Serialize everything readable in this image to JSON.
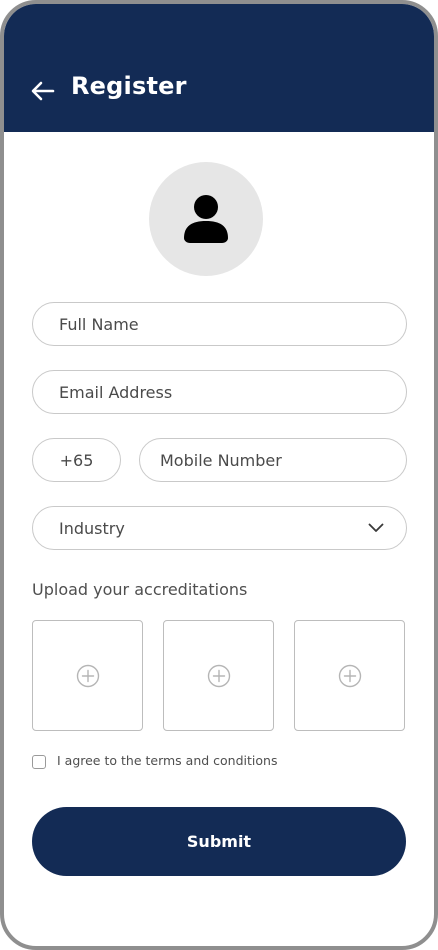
{
  "header": {
    "title": "Register",
    "back_icon": "arrow-left-icon",
    "background_color": "#132b55"
  },
  "avatar": {
    "icon": "user-icon"
  },
  "form": {
    "full_name_placeholder": "Full Name",
    "email_placeholder": "Email Address",
    "country_code_value": "+65",
    "mobile_placeholder": "Mobile Number",
    "industry_value": "Industry",
    "industry_icon": "chevron-down-icon"
  },
  "upload": {
    "label": "Upload your accreditations",
    "slots": [
      {
        "icon": "plus-circle-icon"
      },
      {
        "icon": "plus-circle-icon"
      },
      {
        "icon": "plus-circle-icon"
      }
    ]
  },
  "terms": {
    "label": "I agree to the terms and conditions",
    "checked": false
  },
  "submit": {
    "label": "Submit",
    "background_color": "#132b55"
  }
}
